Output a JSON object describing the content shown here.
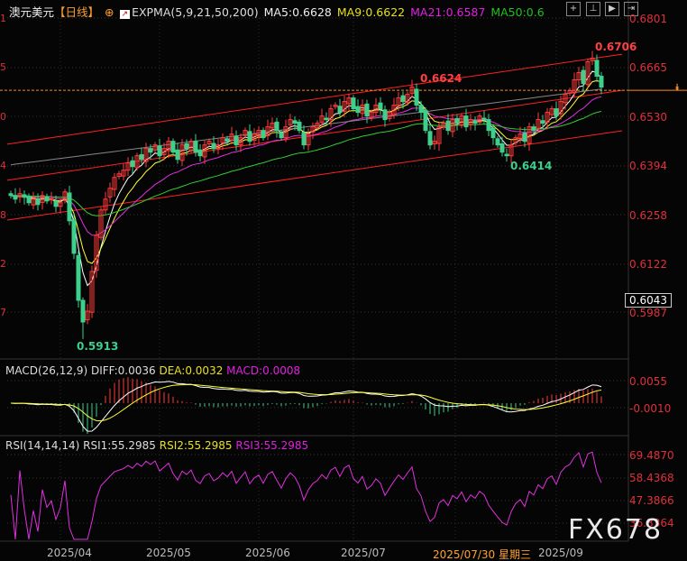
{
  "header": {
    "symbol": "澳元美元",
    "period": "【日线】",
    "indicator": "EXPMA(5,9,21,50,200)",
    "ma5": "MA5:0.6628",
    "ma9": "MA9:0.6622",
    "ma21": "MA21:0.6587",
    "ma50": "MA50:0.6"
  },
  "toolbar": [
    "crosshair",
    "range",
    "play",
    "exit"
  ],
  "price_axis": [
    "0.6801",
    "0.6665",
    "0.6530",
    "0.6394",
    "0.6258",
    "0.6122",
    "0.5987"
  ],
  "current_price": "0.6043",
  "left_axis": [
    "1",
    "5",
    "0",
    "4",
    "8",
    "2",
    "7"
  ],
  "annotations": {
    "high": "0.6706",
    "peak": "0.6624",
    "low2": "0.6414",
    "low": "0.5913"
  },
  "macd": {
    "label": "MACD(26,12,9)",
    "diff": "DIFF:0.0036",
    "dea": "DEA:0.0032",
    "macd": "MACD:0.0008",
    "axis": [
      "0.0055",
      "-0.0010"
    ]
  },
  "rsi": {
    "label": "RSI(14,14,14)",
    "rsi1": "RSI1:55.2985",
    "rsi2": "RSI2:55.2985",
    "rsi3": "RSI3:55.2985",
    "axis": [
      "69.4870",
      "58.4368",
      "47.3866",
      "36.3364"
    ]
  },
  "x_axis": [
    "2025/04",
    "2025/05",
    "2025/06",
    "2025/07",
    "2025/09"
  ],
  "cursor_date": "2025/07/30 星期三",
  "watermark": "FX678",
  "colors": {
    "up": "#ff3b3b",
    "down": "#3cd08c",
    "ma5": "#ffffff",
    "ma9": "#ffff33",
    "ma21": "#e030e0",
    "ma50": "#33cc33",
    "ma200": "#888888",
    "channel": "#ff2020",
    "dashed": "#ff8c1a"
  },
  "chart_data": {
    "type": "candlestick",
    "closes": [
      0.631,
      0.63,
      0.6315,
      0.6305,
      0.629,
      0.63,
      0.6285,
      0.631,
      0.6295,
      0.63,
      0.628,
      0.629,
      0.632,
      0.624,
      0.615,
      0.602,
      0.596,
      0.599,
      0.61,
      0.62,
      0.627,
      0.63,
      0.633,
      0.636,
      0.637,
      0.638,
      0.64,
      0.639,
      0.642,
      0.641,
      0.644,
      0.643,
      0.645,
      0.642,
      0.644,
      0.646,
      0.643,
      0.641,
      0.645,
      0.644,
      0.646,
      0.643,
      0.642,
      0.645,
      0.646,
      0.644,
      0.645,
      0.647,
      0.646,
      0.648,
      0.645,
      0.647,
      0.649,
      0.646,
      0.648,
      0.649,
      0.647,
      0.65,
      0.651,
      0.649,
      0.647,
      0.65,
      0.652,
      0.651,
      0.649,
      0.645,
      0.648,
      0.65,
      0.651,
      0.653,
      0.652,
      0.655,
      0.656,
      0.654,
      0.657,
      0.658,
      0.655,
      0.654,
      0.656,
      0.653,
      0.654,
      0.656,
      0.655,
      0.652,
      0.654,
      0.656,
      0.658,
      0.657,
      0.659,
      0.661,
      0.656,
      0.654,
      0.649,
      0.645,
      0.646,
      0.65,
      0.651,
      0.649,
      0.652,
      0.651,
      0.653,
      0.65,
      0.652,
      0.651,
      0.653,
      0.652,
      0.649,
      0.647,
      0.645,
      0.643,
      0.642,
      0.645,
      0.647,
      0.648,
      0.646,
      0.65,
      0.649,
      0.652,
      0.651,
      0.654,
      0.655,
      0.653,
      0.657,
      0.659,
      0.66,
      0.663,
      0.665,
      0.662,
      0.668,
      0.669,
      0.664,
      0.661
    ],
    "ylim": [
      0.5913,
      0.6801
    ],
    "channels": [
      [
        0.6452,
        0.6701
      ],
      [
        0.6352,
        0.6601
      ],
      [
        0.6242,
        0.6489
      ]
    ],
    "dashed_level": 0.6601
  }
}
